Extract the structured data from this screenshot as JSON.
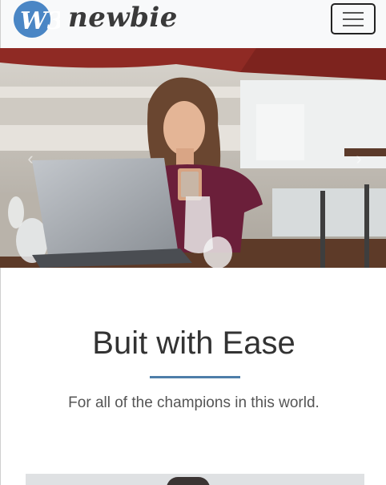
{
  "brand": {
    "name": "newbie",
    "logo_text": "W3"
  },
  "nav": {
    "toggle_icon": "hamburger-icon"
  },
  "carousel": {
    "prev_icon": "chevron-left-icon",
    "next_icon": "chevron-right-icon",
    "prev_glyph": "‹",
    "next_glyph": "›"
  },
  "hero": {
    "title": "Buit with Ease",
    "subtitle": "For all of the champions in this world."
  },
  "colors": {
    "accent": "#4e7ea9",
    "logo": "#4a86c5",
    "navbar_bg": "#f8f9fa"
  }
}
